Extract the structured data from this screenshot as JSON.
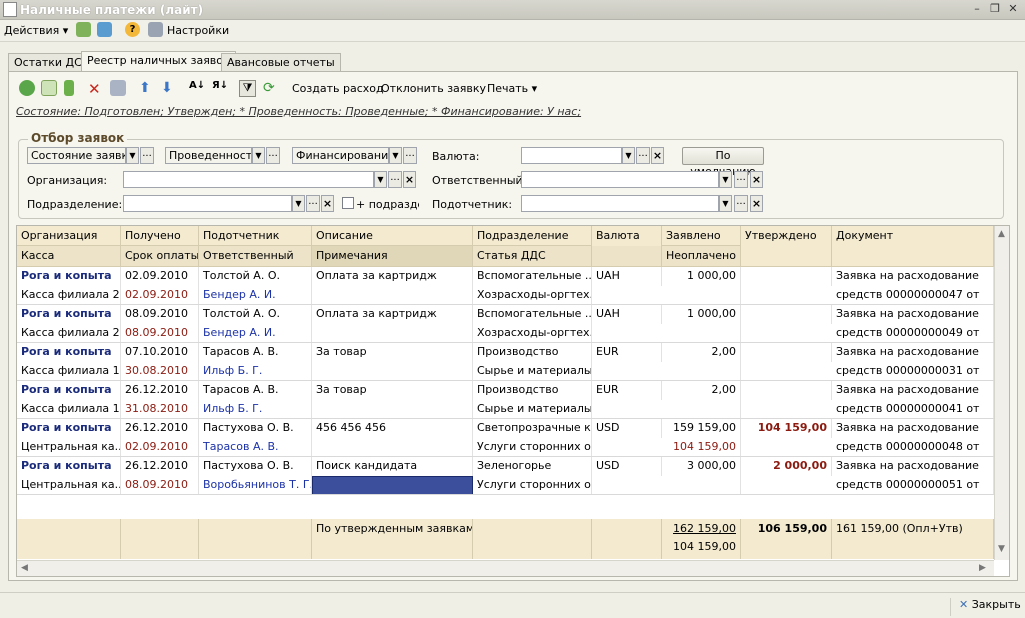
{
  "window": {
    "title": "Наличные платежи (лайт)"
  },
  "menu": {
    "actions": "Действия",
    "settings": "Настройки"
  },
  "tabs": [
    "Остатки ДС",
    "Реестр наличных заявок",
    "Авансовые отчеты"
  ],
  "toolbar": {
    "create_expense": "Создать расход",
    "reject": "Отклонить заявку",
    "print": "Печать"
  },
  "status_line": "Состояние: Подготовлен; Утвержден;  * Проведенность: Проведенные;  * Финансирование: У нас;",
  "filter": {
    "legend": "Отбор заявок",
    "state_field": "Состояние заявки",
    "posted_field": "Проведенность",
    "financing_field": "Финансирование",
    "currency_label": "Валюта:",
    "default_button": "По умолчанию",
    "org_label": "Организация:",
    "responsible_label": "Ответственный:",
    "division_label": "Подразделение:",
    "subdivisions_label": "+ подразделения",
    "accountable_label": "Подотчетник:"
  },
  "grid": {
    "headers_top": [
      "Организация",
      "Получено",
      "Подотчетник",
      "Описание",
      "Подразделение",
      "Валюта",
      "Заявлено",
      "Утверждено",
      "Документ"
    ],
    "headers_bottom": [
      "Касса",
      "Срок оплаты",
      "Ответственный",
      "Примечания",
      "Статья ДДС",
      "",
      "Неоплачено",
      "",
      ""
    ],
    "rows": [
      {
        "org": "Рога и копыта",
        "cash": "Касса филиала 2",
        "received": "02.09.2010",
        "due": "02.09.2010",
        "person": "Толстой А. О.",
        "responsible": "Бендер А. И.",
        "desc": "Оплата за картридж",
        "note": "",
        "division": "Вспомогательные ...",
        "article": "Хозрасходы-оргтех...",
        "currency": "UAH",
        "declared": "1 000,00",
        "unpaid": "",
        "approved": "",
        "doc1": "Заявка на расходование",
        "doc2": "средств 00000000047 от"
      },
      {
        "org": "Рога и копыта",
        "cash": "Касса филиала 2",
        "received": "08.09.2010",
        "due": "08.09.2010",
        "person": "Толстой А. О.",
        "responsible": "Бендер А. И.",
        "desc": "Оплата за картридж",
        "note": "",
        "division": "Вспомогательные ...",
        "article": "Хозрасходы-оргтех...",
        "currency": "UAH",
        "declared": "1 000,00",
        "unpaid": "",
        "approved": "",
        "doc1": "Заявка на расходование",
        "doc2": "средств 00000000049 от"
      },
      {
        "org": "Рога и копыта",
        "cash": "Касса филиала 1...",
        "received": "07.10.2010",
        "due": "30.08.2010",
        "person": "Тарасов А. В.",
        "responsible": "Ильф Б. Г.",
        "desc": "За товар",
        "note": "",
        "division": "Производство",
        "article": "Сырье и материалы",
        "currency": "EUR",
        "declared": "2,00",
        "unpaid": "",
        "approved": "",
        "doc1": "Заявка на расходование",
        "doc2": "средств 00000000031 от"
      },
      {
        "org": "Рога и копыта",
        "cash": "Касса филиала 1...",
        "received": "26.12.2010",
        "due": "31.08.2010",
        "person": "Тарасов А. В.",
        "responsible": "Ильф Б. Г.",
        "desc": "За товар",
        "note": "",
        "division": "Производство",
        "article": "Сырье и материалы",
        "currency": "EUR",
        "declared": "2,00",
        "unpaid": "",
        "approved": "",
        "doc1": "Заявка на расходование",
        "doc2": "средств 00000000041 от"
      },
      {
        "org": "Рога и копыта",
        "cash": "Центральная ка...",
        "received": "26.12.2010",
        "due": "02.09.2010",
        "person": "Пастухова О. В.",
        "responsible": "Тарасов А. В.",
        "desc": "456 456 456",
        "note": "",
        "division": "Светопрозрачные к...",
        "article": "Услуги сторонних о...",
        "currency": "USD",
        "declared": "159 159,00",
        "unpaid": "104 159,00",
        "approved": "104 159,00",
        "doc1": "Заявка на расходование",
        "doc2": "средств 00000000048 от"
      },
      {
        "org": "Рога и копыта",
        "cash": "Центральная ка...",
        "received": "26.12.2010",
        "due": "08.09.2010",
        "person": "Пастухова О. В.",
        "responsible": "Воробьянинов Т. Г.",
        "desc": "Поиск кандидата",
        "note": "",
        "division": "Зеленогорье",
        "article": "Услуги сторонних о...",
        "currency": "USD",
        "declared": "3 000,00",
        "unpaid": "",
        "approved": "2 000,00",
        "doc1": "Заявка на расходование",
        "doc2": "средств 00000000051 от"
      }
    ],
    "footer": {
      "label": "По утвержденным заявкам:",
      "declared": "162 159,00",
      "unpaid": "104 159,00",
      "approved": "106 159,00",
      "doc": "161 159,00 (Опл+Утв)"
    }
  },
  "close_button": "Закрыть"
}
